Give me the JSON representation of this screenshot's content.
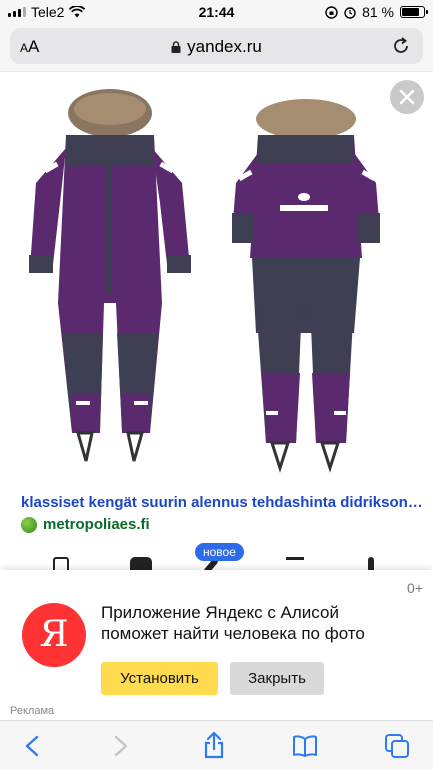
{
  "status_bar": {
    "carrier": "Tele2",
    "time": "21:44",
    "battery_percent": "81 %",
    "battery_level": 0.81
  },
  "browser": {
    "text_size_label": "AA",
    "url": "yandex.ru"
  },
  "result": {
    "title": "klassiset kengät suurin alennus tehdashinta didrikson…",
    "source": "metropoliaes.fi"
  },
  "actions": {
    "new_badge": "новое"
  },
  "ad": {
    "counter": "0+",
    "logo_letter": "Я",
    "text": "Приложение Яндекс с Алисой поможет найти человека по фото",
    "install_label": "Установить",
    "close_label": "Закрыть",
    "ad_label": "Реклама"
  },
  "colors": {
    "link_blue": "#1a47c8",
    "source_green": "#0a6b2c",
    "yandex_red": "#ff3333",
    "install_yellow": "#ffdb4d",
    "toolbar_blue": "#2f7bf5",
    "snowsuit_purple": "#5b2a6e",
    "snowsuit_grey": "#3e3f52"
  },
  "icons": [
    "wifi-icon",
    "lock-icon",
    "reload-icon",
    "close-icon",
    "back-icon",
    "forward-icon",
    "share-icon",
    "bookmarks-icon",
    "tabs-icon"
  ]
}
